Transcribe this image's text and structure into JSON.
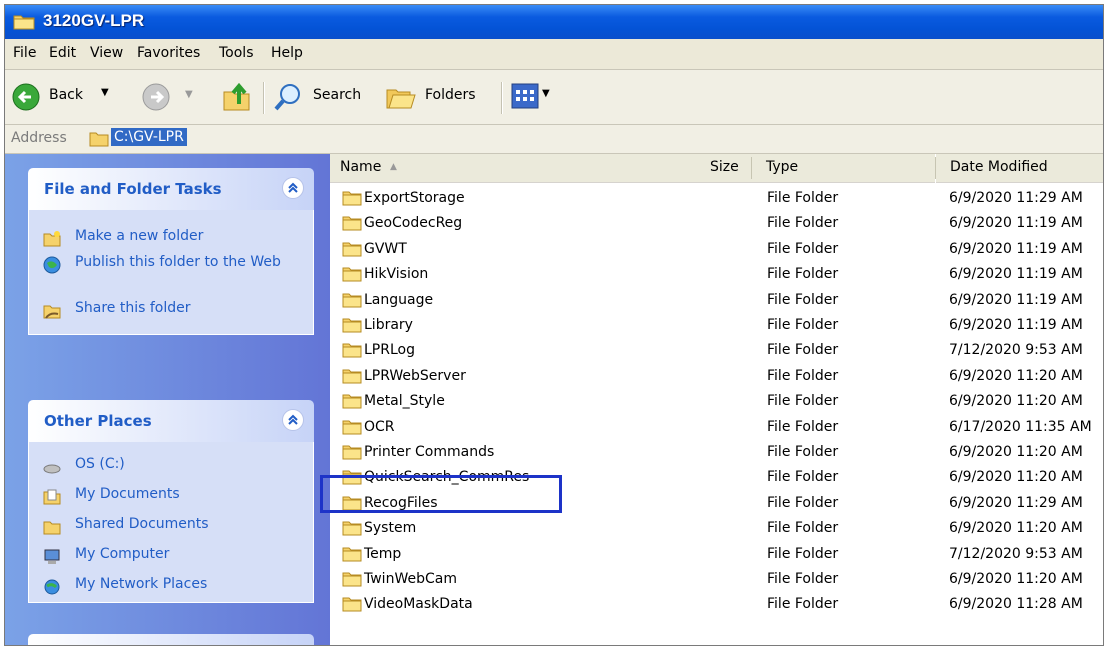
{
  "window": {
    "title": "3120GV-LPR"
  },
  "menu": [
    "File",
    "Edit",
    "View",
    "Favorites",
    "Tools",
    "Help"
  ],
  "toolbar": {
    "back_label": "Back",
    "search_label": "Search",
    "folders_label": "Folders"
  },
  "address": {
    "label": "Address",
    "value": "C:\\GV-LPR"
  },
  "tasks_panel": {
    "title": "File and Folder Tasks",
    "items": [
      "Make a new folder",
      "Publish this folder to the Web",
      "Share this folder"
    ]
  },
  "other_places": {
    "title": "Other Places",
    "items": [
      "OS (C:)",
      "My Documents",
      "Shared Documents",
      "My Computer",
      "My Network Places"
    ]
  },
  "columns": {
    "name": "Name",
    "size": "Size",
    "type": "Type",
    "date": "Date Modified"
  },
  "files": [
    {
      "name": "ExportStorage",
      "type": "File Folder",
      "date": "6/9/2020 11:29 AM"
    },
    {
      "name": "GeoCodecReg",
      "type": "File Folder",
      "date": "6/9/2020 11:19 AM"
    },
    {
      "name": "GVWT",
      "type": "File Folder",
      "date": "6/9/2020 11:19 AM"
    },
    {
      "name": "HikVision",
      "type": "File Folder",
      "date": "6/9/2020 11:19 AM"
    },
    {
      "name": "Language",
      "type": "File Folder",
      "date": "6/9/2020 11:19 AM"
    },
    {
      "name": "Library",
      "type": "File Folder",
      "date": "6/9/2020 11:19 AM"
    },
    {
      "name": "LPRLog",
      "type": "File Folder",
      "date": "7/12/2020 9:53 AM"
    },
    {
      "name": "LPRWebServer",
      "type": "File Folder",
      "date": "6/9/2020 11:20 AM"
    },
    {
      "name": "Metal_Style",
      "type": "File Folder",
      "date": "6/9/2020 11:20 AM"
    },
    {
      "name": "OCR",
      "type": "File Folder",
      "date": "6/17/2020 11:35 AM"
    },
    {
      "name": "Printer Commands",
      "type": "File Folder",
      "date": "6/9/2020 11:20 AM"
    },
    {
      "name": "QuickSearch_CommRes",
      "type": "File Folder",
      "date": "6/9/2020 11:20 AM"
    },
    {
      "name": "RecogFiles",
      "type": "File Folder",
      "date": "6/9/2020 11:29 AM"
    },
    {
      "name": "System",
      "type": "File Folder",
      "date": "6/9/2020 11:20 AM"
    },
    {
      "name": "Temp",
      "type": "File Folder",
      "date": "7/12/2020 9:53 AM"
    },
    {
      "name": "TwinWebCam",
      "type": "File Folder",
      "date": "6/9/2020 11:20 AM"
    },
    {
      "name": "VideoMaskData",
      "type": "File Folder",
      "date": "6/9/2020 11:28 AM"
    }
  ],
  "colors": {
    "titlebar": "#0a5be0",
    "highlight": "#1d33c8",
    "task_text": "#215dc6",
    "selection": "#316ac5"
  }
}
